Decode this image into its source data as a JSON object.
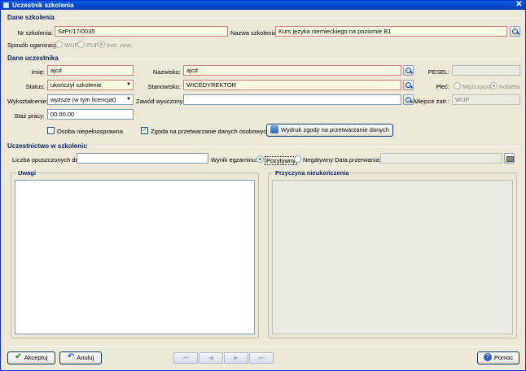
{
  "window": {
    "title": "Uczestnik szkolenia",
    "close_glyph": "✕"
  },
  "dane_szkolenia": {
    "section_title": "Dane szkolenia",
    "nr_label": "Nr szkolenia:",
    "nr_value": "SzPr/17/0035",
    "nazwa_label": "Nazwa szkolenia:",
    "nazwa_value": "Kurs języka niemieckiego na poziomie B1",
    "sposob_label": "Sposób oganizacji:",
    "sposob_options": [
      "WUP",
      "PUP",
      "Inst. zew."
    ],
    "sposob_selected": "Inst. zew."
  },
  "dane_uczestnika": {
    "section_title": "Dane uczestnika",
    "imie_label": "Imię:",
    "imie_value": "ajcd",
    "nazwisko_label": "Nazwisko:",
    "nazwisko_value": "ajcd",
    "pesel_label": "PESEL:",
    "pesel_value": "",
    "status_label": "Status:",
    "status_value": "ukończył szkolenie",
    "stanowisko_label": "Stanowisko:",
    "stanowisko_value": "WICEDYREKTOR",
    "plec_label": "Płeć:",
    "plec_options": [
      "Mężczyzna",
      "Kobieta"
    ],
    "plec_selected": "Kobieta",
    "wyksztalcenie_label": "Wykształcenie:",
    "wyksztalcenie_value": "wyższe (w tym licencjat)",
    "zawod_label": "Zawód wyuczony:",
    "zawod_value": "",
    "miejsce_label": "Miejsce zatr.:",
    "miejsce_value": "WUP",
    "staz_label": "Staż pracy:",
    "staz_value": "00.00.00",
    "niepelnosprawna_label": "Osoba niepełnosprawna",
    "niepelnosprawna_checked": false,
    "zgoda_label": "Zgoda na przetwarzanie danych osobowych",
    "zgoda_checked": true,
    "wydruk_button": "Wydruk zgody na przetwarzanie danych"
  },
  "uczestnictwo": {
    "section_title": "Uczestnictwo w szkoleniu",
    "opuszczone_label": "Liczba opuszczonych dni:",
    "opuszczone_value": "",
    "wynik_label": "Wynik egzaminu:",
    "wynik_options": [
      "Pozytywny",
      "Negatywny"
    ],
    "wynik_selected": "Pozytywny",
    "data_przerwania_label": "Data przerwania:",
    "data_przerwania_value": "",
    "uwagi_title": "Uwagi",
    "uwagi_value": "",
    "przyczyna_title": "Przyczyna nieukończenia",
    "przyczyna_value": ""
  },
  "footer": {
    "akceptuj": "Akceptuj",
    "anuluj": "Anuluj",
    "pomoc": "Pomoc",
    "nav": [
      "first",
      "prev",
      "next",
      "last"
    ]
  },
  "colors": {
    "accent": "#0a246a",
    "required_bg": "#fffbe0",
    "titlebar": "#0546c9",
    "ok_green": "#21a121"
  }
}
